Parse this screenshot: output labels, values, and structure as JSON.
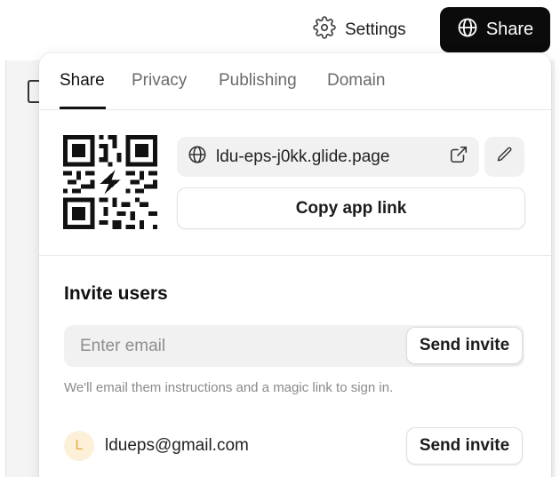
{
  "topbar": {
    "settings_label": "Settings",
    "share_label": "Share"
  },
  "tabs": [
    {
      "label": "Share",
      "active": true
    },
    {
      "label": "Privacy",
      "active": false
    },
    {
      "label": "Publishing",
      "active": false
    },
    {
      "label": "Domain",
      "active": false
    }
  ],
  "share": {
    "app_url": "ldu-eps-j0kk.glide.page",
    "copy_label": "Copy app link"
  },
  "invite": {
    "title": "Invite users",
    "email_placeholder": "Enter email",
    "email_value": "",
    "send_label": "Send invite",
    "hint": "We'll email them instructions and a magic link to sign in."
  },
  "users": [
    {
      "initial": "L",
      "email": "ldueps@gmail.com",
      "send_label": "Send invite"
    }
  ],
  "colors": {
    "primary_button": "#0b0b0b",
    "avatar_bg": "#fdf0d9",
    "avatar_fg": "#e7a93c"
  }
}
